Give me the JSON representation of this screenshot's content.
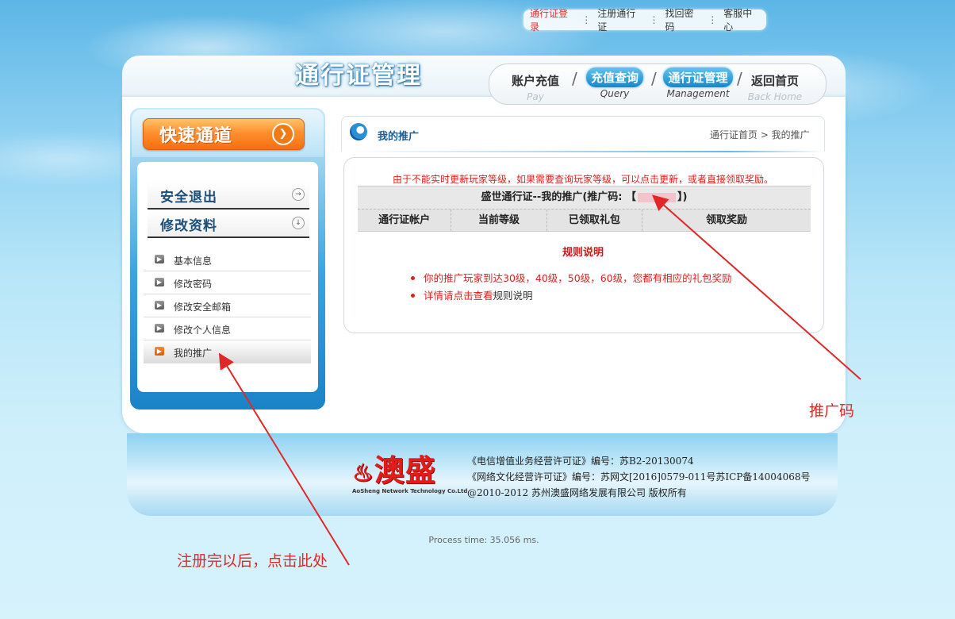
{
  "top_links": {
    "login": "通行证登录",
    "register": "注册通行证",
    "recover": "找回密码",
    "service": "客服中心",
    "separator": "⋮"
  },
  "header": {
    "title": "通行证管理",
    "nav": [
      {
        "cn": "账户充值",
        "en": "Pay",
        "active": false
      },
      {
        "cn": "充值查询",
        "en": "Query",
        "active": true
      },
      {
        "cn": "通行证管理",
        "en": "Management",
        "active": true
      },
      {
        "cn": "返回首页",
        "en": "Back Home",
        "active": false
      }
    ],
    "slash": "/"
  },
  "sidebar": {
    "quick_label": "快速通道",
    "quick_arrow": "❯",
    "logout": "安全退出",
    "edit_profile": "修改资料",
    "items": [
      {
        "label": "基本信息",
        "active": false
      },
      {
        "label": "修改密码",
        "active": false
      },
      {
        "label": "修改安全邮箱",
        "active": false
      },
      {
        "label": "修改个人信息",
        "active": false
      },
      {
        "label": "我的推广",
        "active": true
      }
    ]
  },
  "content": {
    "title": "我的推广",
    "breadcrumb": "通行证首页 > 我的推广",
    "notice": "由于不能实时更新玩家等级，如果需要查询玩家等级，可以点击更新，或者直接领取奖励。",
    "table_title_prefix": "盛世通行证--我的推广(推广码: 【",
    "table_title_suffix": "】)",
    "columns": [
      "通行证帐户",
      "当前等级",
      "已领取礼包",
      "领取奖励"
    ],
    "rules_title": "规则说明",
    "rules": [
      {
        "text": "你的推广玩家到达30级，40级，50级，60级，您都有相应的礼包奖励"
      },
      {
        "text_red": "详情请点击查看",
        "text_black": "规则说明"
      }
    ]
  },
  "footer": {
    "logo_text": "澳盛",
    "logo_sub": "AoSheng Network Technology Co.Ltd",
    "lines": [
      "《电信增值业务经营许可证》编号：苏B2-20130074",
      "《网络文化经营许可证》编号：苏网文[2016]0579-011号苏ICP备14004068号",
      "@2010-2012 苏州澳盛网络发展有限公司 版权所有"
    ]
  },
  "process_time": "Process time: 35.056 ms.",
  "annotations": {
    "code_label": "推广码",
    "click_label": "注册完以后，点击此处",
    "color": "#e02828"
  }
}
